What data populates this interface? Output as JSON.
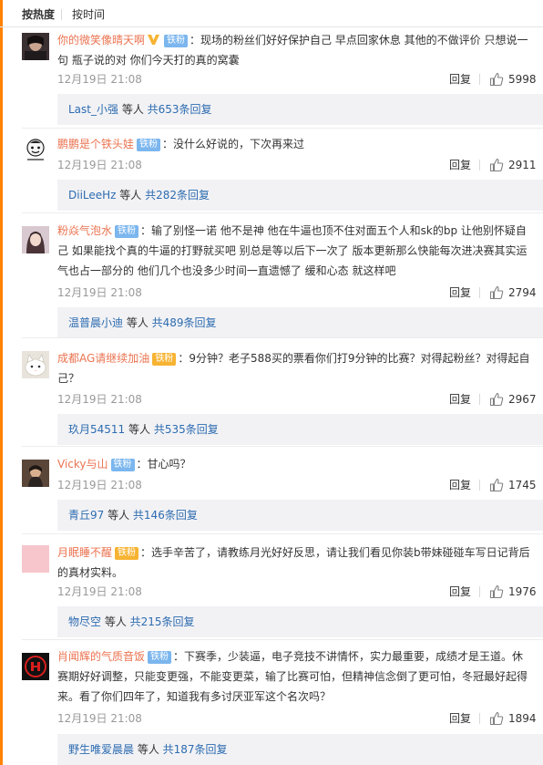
{
  "sort": {
    "hot": "按热度",
    "time": "按时间"
  },
  "comments": [
    {
      "user": "你的微笑像晴天啊",
      "badge": "铁粉",
      "verified": true,
      "badge_style": "blue",
      "text": "：现场的粉丝们好好保护自己 早点回家休息 其他的不做评价 只想说一句 瓶子说的对 你们今天打的真的窝囊",
      "time": "12月19日 21:08",
      "reply": "回复",
      "likes": "5998",
      "sub_user": "Last_小强",
      "sub_mid": " 等人 ",
      "sub_count": "共653条回复",
      "avatar": "photo-dark"
    },
    {
      "user": "鹏鹏是个铁头娃",
      "badge": "铁粉",
      "verified": false,
      "badge_style": "blue",
      "text": "：没什么好说的，下次再来过",
      "time": "12月19日 21:08",
      "reply": "回复",
      "likes": "2911",
      "sub_user": "DiiLeeHz",
      "sub_mid": " 等人 ",
      "sub_count": "共282条回复",
      "avatar": "meme"
    },
    {
      "user": "粉焱气泡水",
      "badge": "铁粉",
      "verified": false,
      "badge_style": "blue",
      "text": "：输了别怪一诺 他不是神 他在牛逼也顶不住对面五个人和sk的bp 让他别怀疑自己 如果能找个真的牛逼的打野就买吧 别总是等以后下一次了 版本更新那么快能每次进决赛其实运气也占一部分的 他们几个也没多少时间一直遗憾了 缓和心态 就这样吧",
      "time": "12月19日 21:08",
      "reply": "回复",
      "likes": "2794",
      "sub_user": "温普晨小迪",
      "sub_mid": " 等人 ",
      "sub_count": "共489条回复",
      "avatar": "girl"
    },
    {
      "user": "成都AG请继续加油",
      "badge": "铁粉",
      "verified": false,
      "badge_style": "gold",
      "text": "：9分钟？老子588买的票看你们打9分钟的比赛？对得起粉丝？对得起自己？",
      "time": "12月19日 21:08",
      "reply": "回复",
      "likes": "2967",
      "sub_user": "玖月54511",
      "sub_mid": " 等人 ",
      "sub_count": "共535条回复",
      "avatar": "cat"
    },
    {
      "user": "Vicky与山",
      "badge": "铁粉",
      "verified": false,
      "badge_style": "blue",
      "text": "：甘心吗？",
      "time": "12月19日 21:08",
      "reply": "回复",
      "likes": "1745",
      "sub_user": "青丘97",
      "sub_mid": " 等人 ",
      "sub_count": "共146条回复",
      "avatar": "photo-warm"
    },
    {
      "user": "月眠睡不醒",
      "badge": "铁粉",
      "verified": false,
      "badge_style": "gold",
      "text": "：选手辛苦了，请教练月光好好反思，请让我们看见你装b带妹碰碰车写日记背后的真材实料。",
      "time": "12月19日 21:08",
      "reply": "回复",
      "likes": "1976",
      "sub_user": "物尽空",
      "sub_mid": " 等人 ",
      "sub_count": "共215条回复",
      "avatar": "pink"
    },
    {
      "user": "肖闻辉的气质音饭",
      "badge": "铁粉",
      "verified": false,
      "badge_style": "blue",
      "text": "：下赛季，少装逼，电子竞技不讲情怀，实力最重要，成绩才是王道。休赛期好好调整，只能变更强，不能变更菜，输了比赛可怕，但精神信念倒了更可怕，冬冠最好起得来。看了你们四年了，知道我有多讨厌亚军这个名次吗？",
      "time": "12月19日 21:08",
      "reply": "回复",
      "likes": "1894",
      "sub_user": "野生唯爱晨晨",
      "sub_mid": " 等人 ",
      "sub_count": "共187条回复",
      "avatar": "logo"
    }
  ]
}
